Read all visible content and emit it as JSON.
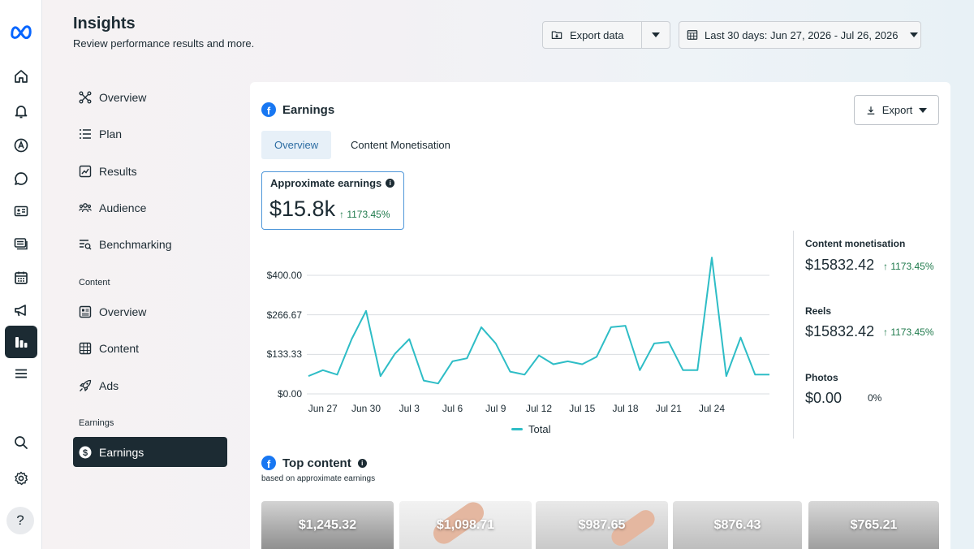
{
  "header": {
    "title": "Insights",
    "subtitle": "Review performance results and more.",
    "export_data_label": "Export data",
    "date_range_label": "Last 30 days: Jun 27, 2026 - Jul 26, 2026"
  },
  "rail": {
    "icons": [
      "meta-logo-icon",
      "home-icon",
      "bell-icon",
      "compass-icon",
      "chat-icon",
      "id-card-icon",
      "pages-icon",
      "calendar-icon",
      "megaphone-icon",
      "insights-icon",
      "menu-icon",
      "search-icon",
      "gear-icon",
      "help-icon"
    ],
    "help_label": "?"
  },
  "sidebar": {
    "items_top": [
      {
        "label": "Overview",
        "icon": "overview-icon"
      },
      {
        "label": "Plan",
        "icon": "plan-icon"
      },
      {
        "label": "Results",
        "icon": "results-icon"
      },
      {
        "label": "Audience",
        "icon": "audience-icon"
      },
      {
        "label": "Benchmarking",
        "icon": "benchmarking-icon"
      }
    ],
    "section_content": "Content",
    "items_content": [
      {
        "label": "Overview",
        "icon": "content-overview-icon"
      },
      {
        "label": "Content",
        "icon": "content-grid-icon"
      },
      {
        "label": "Ads",
        "icon": "rocket-icon"
      }
    ],
    "section_earnings": "Earnings",
    "items_earnings": [
      {
        "label": "Earnings",
        "icon": "dollar-icon",
        "active": true
      }
    ]
  },
  "earnings": {
    "title": "Earnings",
    "export_label": "Export",
    "tabs": [
      {
        "label": "Overview",
        "active": true
      },
      {
        "label": "Content Monetisation",
        "active": false
      }
    ],
    "kpi": {
      "label": "Approximate earnings",
      "value": "$15.8k",
      "delta": "↑ 1173.45%"
    },
    "stats": [
      {
        "label": "Content monetisation",
        "value": "$15832.42",
        "delta": "↑ 1173.45%"
      },
      {
        "label": "Reels",
        "value": "$15832.42",
        "delta": "↑ 1173.45%"
      },
      {
        "label": "Photos",
        "value": "$0.00",
        "delta": "0%"
      }
    ]
  },
  "chart_data": {
    "type": "line",
    "y_ticks": [
      "$400.00",
      "$266.67",
      "$133.33",
      "$0.00"
    ],
    "ylim": [
      0,
      400
    ],
    "x_tick_labels": [
      "Jun 27",
      "Jun 30",
      "Jul 3",
      "Jul 6",
      "Jul 9",
      "Jul 12",
      "Jul 15",
      "Jul 18",
      "Jul 21",
      "Jul 24"
    ],
    "x_tick_index": [
      1,
      4,
      7,
      10,
      13,
      16,
      19,
      22,
      25,
      28
    ],
    "legend": "Total",
    "series": [
      {
        "name": "Total",
        "color": "#2ebdc6",
        "values": [
          60,
          80,
          65,
          185,
          280,
          60,
          135,
          185,
          45,
          35,
          110,
          120,
          225,
          170,
          75,
          65,
          130,
          100,
          110,
          100,
          125,
          225,
          230,
          80,
          170,
          175,
          80,
          80,
          460,
          60,
          190,
          65,
          65
        ]
      }
    ],
    "grid": true
  },
  "top_content": {
    "title": "Top content",
    "subtitle": "based on approximate earnings",
    "items": [
      "$1,245.32",
      "$1,098.71",
      "$987.65",
      "$876.43",
      "$765.21"
    ]
  }
}
